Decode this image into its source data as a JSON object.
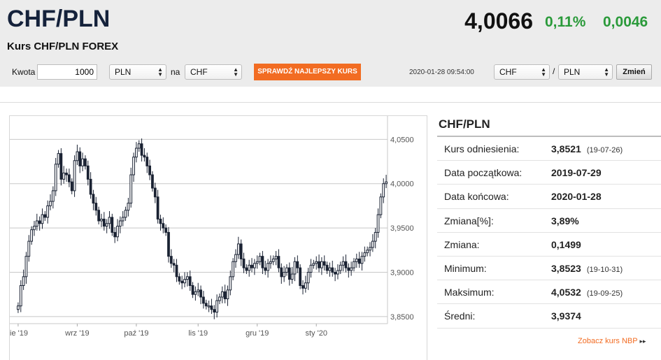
{
  "header": {
    "pair": "CHF/PLN",
    "subtitle": "Kurs CHF/PLN FOREX",
    "rate": "4,0066",
    "change_pct": "0,11%",
    "change_abs": "0,0046"
  },
  "converter": {
    "amount_label": "Kwota",
    "amount_value": "1000",
    "from_currency": "PLN",
    "na_label": "na",
    "to_currency": "CHF",
    "best_rate_button": "SPRAWDŹ NAJLEPSZY KURS",
    "datetime": "2020-01-28 09:54:00",
    "pair_base": "CHF",
    "pair_sep": "/",
    "pair_quote": "PLN",
    "change_button": "Zmień"
  },
  "info": {
    "title": "CHF/PLN",
    "rows": [
      {
        "label": "Kurs odniesienia:",
        "value": "3,8521",
        "date": "(19-07-26)"
      },
      {
        "label": "Data początkowa:",
        "value": "2019-07-29",
        "date": ""
      },
      {
        "label": "Data końcowa:",
        "value": "2020-01-28",
        "date": ""
      },
      {
        "label": "Zmiana[%]:",
        "value": "3,89%",
        "date": ""
      },
      {
        "label": "Zmiana:",
        "value": "0,1499",
        "date": ""
      },
      {
        "label": "Minimum:",
        "value": "3,8523",
        "date": "(19-10-31)"
      },
      {
        "label": "Maksimum:",
        "value": "4,0532",
        "date": "(19-09-25)"
      },
      {
        "label": "Średni:",
        "value": "3,9374",
        "date": ""
      }
    ],
    "nbp_link": "Zobacz kurs NBP",
    "nbp_arrow": "▸▸"
  },
  "colors": {
    "up": "#ffffff",
    "down": "#1a2233",
    "accent": "#f26c22",
    "positive": "#2a9a3a"
  },
  "chart_data": {
    "type": "candlestick",
    "x_tick_labels": [
      "ie '19",
      "wrz '19",
      "paź '19",
      "lis '19",
      "gru '19",
      "sty '20"
    ],
    "y_tick_labels": [
      "4,0500",
      "4,0000",
      "3,9500",
      "3,9000",
      "3,8500"
    ],
    "y_ticks": [
      4.05,
      4.0,
      3.95,
      3.9,
      3.85
    ],
    "ylim": [
      3.842,
      4.07
    ],
    "grid": "horizontal",
    "close": [
      3.862,
      3.885,
      3.895,
      3.918,
      3.935,
      3.948,
      3.952,
      3.958,
      3.955,
      3.965,
      3.962,
      3.975,
      3.98,
      3.992,
      4.022,
      4.034,
      4.005,
      4.012,
      4.01,
      4.002,
      3.992,
      4.026,
      4.036,
      4.02,
      4.028,
      4.02,
      4.005,
      3.988,
      3.978,
      3.97,
      3.958,
      3.96,
      3.952,
      3.955,
      3.962,
      3.945,
      3.94,
      3.952,
      3.958,
      3.962,
      3.97,
      3.978,
      4.01,
      4.03,
      4.04,
      4.045,
      4.032,
      4.03,
      4.02,
      4.01,
      3.995,
      3.985,
      3.96,
      3.955,
      3.95,
      3.945,
      3.918,
      3.91,
      3.908,
      3.895,
      3.89,
      3.888,
      3.892,
      3.895,
      3.885,
      3.875,
      3.878,
      3.88,
      3.872,
      3.865,
      3.862,
      3.862,
      3.858,
      3.855,
      3.868,
      3.872,
      3.878,
      3.87,
      3.88,
      3.895,
      3.912,
      3.92,
      3.932,
      3.915,
      3.905,
      3.902,
      3.908,
      3.905,
      3.91,
      3.912,
      3.918,
      3.905,
      3.902,
      3.91,
      3.912,
      3.915,
      3.918,
      3.905,
      3.895,
      3.9,
      3.905,
      3.892,
      3.898,
      3.912,
      3.905,
      3.885,
      3.882,
      3.888,
      3.9,
      3.908,
      3.91,
      3.912,
      3.905,
      3.912,
      3.908,
      3.902,
      3.905,
      3.9,
      3.898,
      3.902,
      3.908,
      3.912,
      3.905,
      3.902,
      3.905,
      3.912,
      3.915,
      3.91,
      3.918,
      3.922,
      3.925,
      3.928,
      3.935,
      3.945,
      3.965,
      3.985,
      4.0,
      4.002
    ],
    "x_tick_index": [
      0,
      22,
      44,
      67,
      89,
      111
    ]
  }
}
